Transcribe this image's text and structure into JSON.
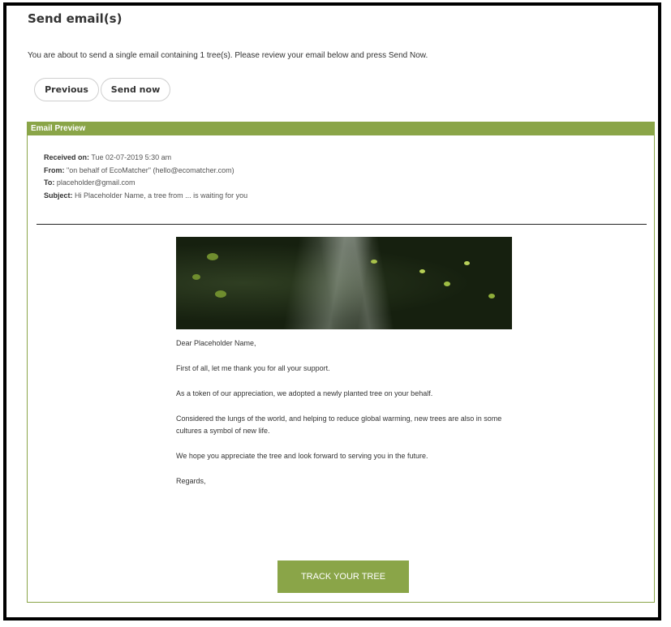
{
  "page": {
    "title": "Send email(s)",
    "intro": "You are about to send a single email containing 1 tree(s). Please review your email below and press Send Now."
  },
  "actions": {
    "previous_label": "Previous",
    "send_label": "Send now"
  },
  "preview": {
    "header": "Email Preview",
    "received_label": "Received on:",
    "received_value": "Tue 02-07-2019 5:30 am",
    "from_label": "From:",
    "from_value": "\"on behalf of EcoMatcher\" (hello@ecomatcher.com)",
    "to_label": "To:",
    "to_value": "placeholder@gmail.com",
    "subject_label": "Subject:",
    "subject_value": "Hi Placeholder Name, a tree from ... is waiting for you"
  },
  "email": {
    "greeting": "Dear Placeholder Name,",
    "p1": "First of all, let me thank you for all your support.",
    "p2": "As a token of our appreciation, we adopted a newly planted tree on your behalf.",
    "p3": "Considered the lungs of the world, and helping to reduce global warming, new trees are also in some cultures a symbol of new life.",
    "p4": "We hope you appreciate the tree and look forward to serving you in the future.",
    "closing": "Regards,",
    "cta_label": "TRACK YOUR TREE"
  },
  "colors": {
    "accent": "#8aa548"
  }
}
